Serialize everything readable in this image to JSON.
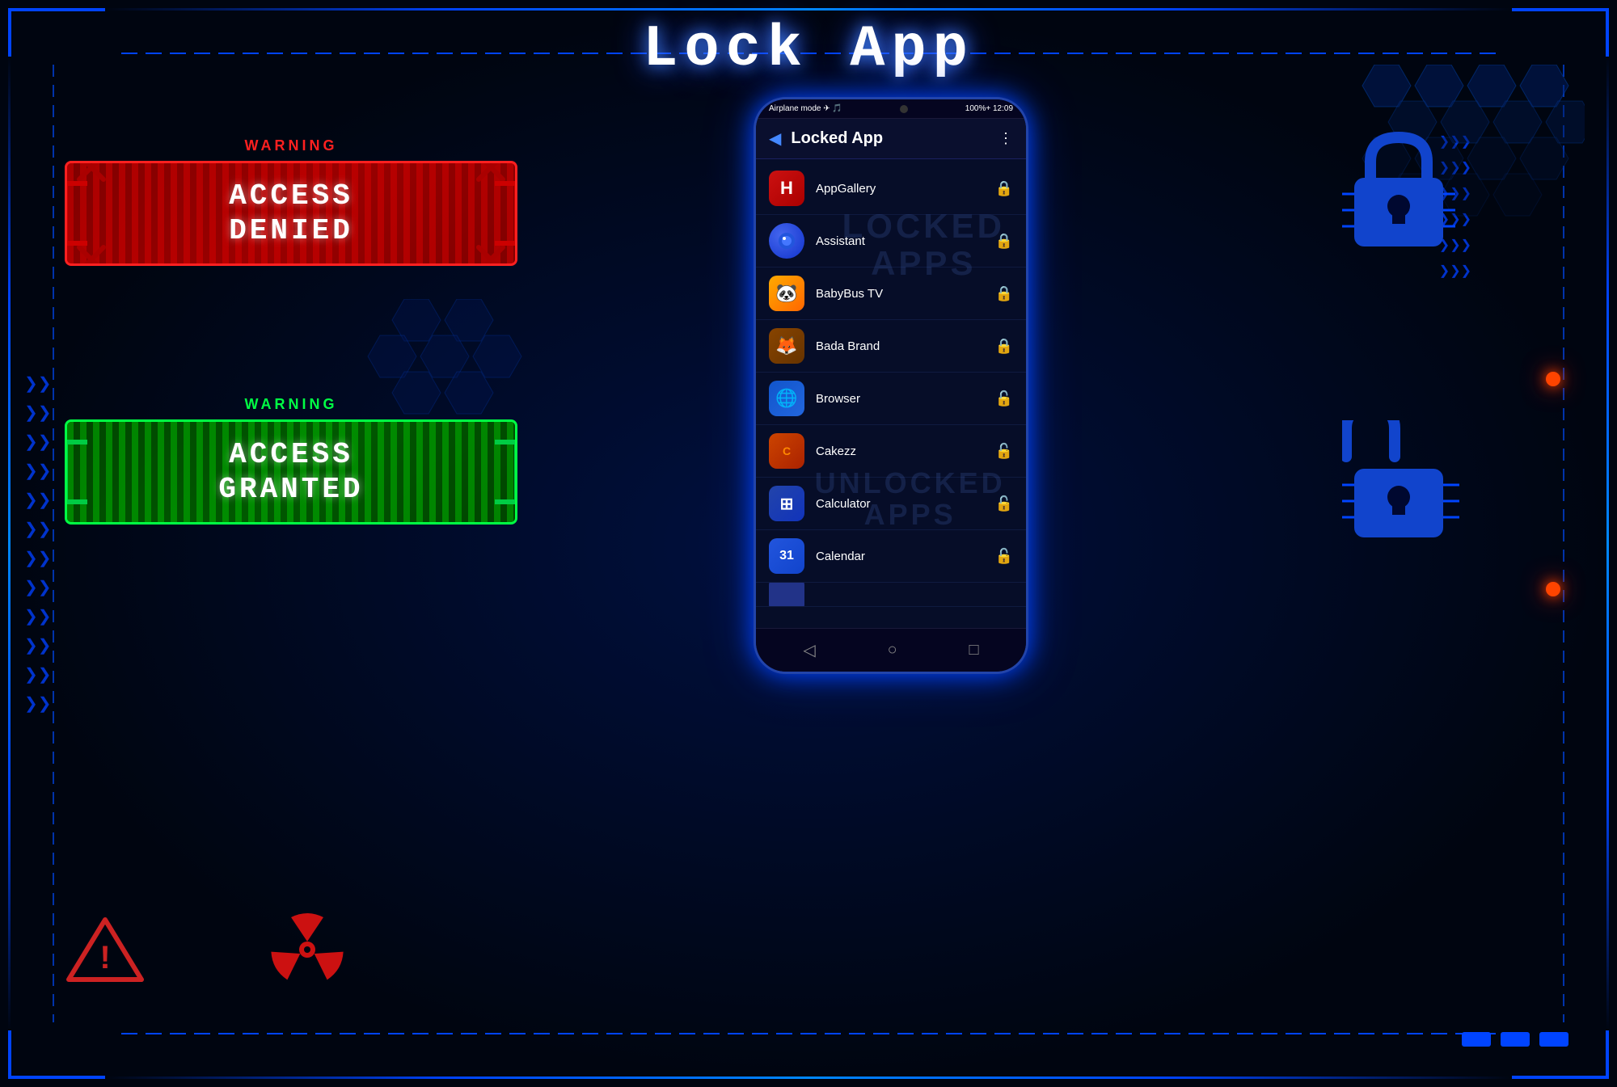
{
  "page": {
    "title": "Lock App",
    "background_color": "#000510"
  },
  "phone": {
    "status_bar": {
      "left": "Airplane mode ✈ 🎵",
      "right": "100%+ 12:09"
    },
    "header": {
      "title": "Locked App",
      "back_label": "◀",
      "menu_label": "⋮"
    },
    "apps": [
      {
        "name": "AppGallery",
        "icon_label": "H",
        "icon_class": "app-icon-appgallery",
        "locked": true
      },
      {
        "name": "Assistant",
        "icon_label": "●",
        "icon_class": "app-icon-assistant",
        "locked": true
      },
      {
        "name": "BabyBus TV",
        "icon_label": "🐼",
        "icon_class": "app-icon-babybus",
        "locked": true
      },
      {
        "name": "Bada Brand",
        "icon_label": "🦊",
        "icon_class": "app-icon-bada",
        "locked": true
      },
      {
        "name": "Browser",
        "icon_label": "🌐",
        "icon_class": "app-icon-browser",
        "locked": false
      },
      {
        "name": "Cakezz",
        "icon_label": "C",
        "icon_class": "app-icon-cakezz",
        "locked": false
      },
      {
        "name": "Calculator",
        "icon_label": "÷",
        "icon_class": "app-icon-calculator",
        "locked": false
      },
      {
        "name": "Calendar",
        "icon_label": "31",
        "icon_class": "app-icon-calendar",
        "locked": false
      }
    ],
    "overlay_locked": "LOCKED\nAPPS",
    "overlay_unlocked": "UNLOCKED\nAPPS",
    "nav": {
      "back": "◁",
      "home": "○",
      "recent": "□"
    }
  },
  "access_denied": {
    "warning_label": "WARNING",
    "line1": "ACCESS",
    "line2": "DENIED"
  },
  "access_granted": {
    "warning_label": "WARNING",
    "line1": "ACCESS",
    "line2": "GRANTED"
  },
  "colors": {
    "accent_blue": "#0044ff",
    "denied_red": "#cc0000",
    "granted_green": "#00cc44",
    "text_white": "#ffffff",
    "bg_dark": "#000510"
  }
}
